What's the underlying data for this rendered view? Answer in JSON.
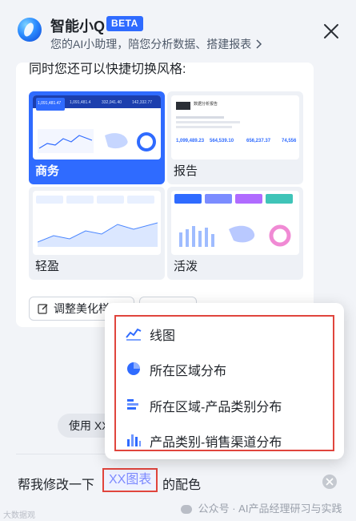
{
  "header": {
    "title": "智能小Q",
    "badge": "BETA",
    "subtitle": "您的AI小助理，陪您分析数据、搭建报表"
  },
  "style_panel": {
    "intro": "同时您还可以快捷切换风格:",
    "styles": [
      {
        "label": "商务",
        "selected": true
      },
      {
        "label": "报告",
        "selected": false
      },
      {
        "label": "轻盈",
        "selected": false
      },
      {
        "label": "活泼",
        "selected": false
      }
    ],
    "adjust_button": "调整美化样",
    "thumb_numbers": [
      "1,091,481.47",
      "1,091,481.4",
      "332,041.40",
      "142,332.77",
      "1,099,489.23",
      "564,539.10",
      "656,237.37",
      "74,556"
    ],
    "report_title": "数据分析报告"
  },
  "suggestion_chip": "使用 XX",
  "dropdown": {
    "items": [
      {
        "label": "线图",
        "icon": "line-chart-icon"
      },
      {
        "label": "所在区域分布",
        "icon": "pie-chart-icon"
      },
      {
        "label": "所在区域-产品类别分布",
        "icon": "bar-chart-icon"
      },
      {
        "label": "产品类别-销售渠道分布",
        "icon": "column-chart-icon"
      }
    ]
  },
  "input": {
    "prefix": "帮我修改一下",
    "placeholder": "XX图表",
    "suffix": "的配色"
  },
  "watermark": {
    "left": "大数据观",
    "right": "公众号 · AI产品经理研习与实践"
  },
  "colors": {
    "accent": "#2f6bff",
    "highlight_border": "#e0453d"
  }
}
